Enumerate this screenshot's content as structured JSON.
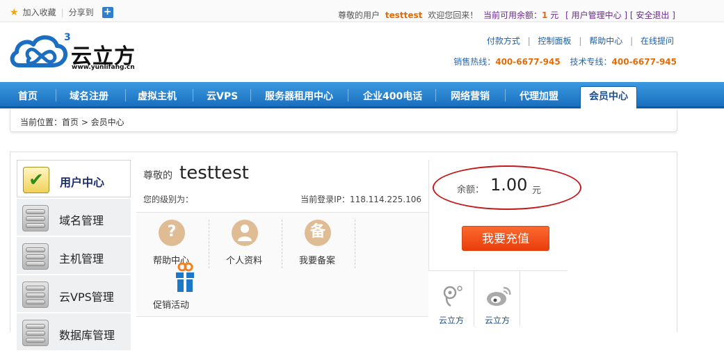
{
  "topbar": {
    "favorite": "加入收藏",
    "share": "分享到",
    "share_plus": "+",
    "greeting_prefix": "尊敬的用户",
    "username": "testtest",
    "welcome": "欢迎您回来！",
    "balance_prefix": "当前可用余额：",
    "balance": "1",
    "balance_unit": "元",
    "user_center": "[ 用户管理中心 ]",
    "logout": "[ 安全退出 ]"
  },
  "header": {
    "logo_cn": "云立方",
    "logo_url": "www.yunlifang.cn",
    "logo_sup": "3",
    "links": [
      "付款方式",
      "控制面板",
      "帮助中心",
      "在线提问"
    ],
    "sales_label": "销售热线：",
    "sales_phone": "400-6677-945",
    "tech_label": "技术专线：",
    "tech_phone": "400-6677-945"
  },
  "nav": {
    "items": [
      "首页",
      "域名注册",
      "虚拟主机",
      "云VPS",
      "服务器租用中心",
      "企业400电话",
      "网络营销",
      "代理加盟"
    ],
    "active": "会员中心"
  },
  "breadcrumb": "当前位置：首页 > 会员中心",
  "sidebar": {
    "items": [
      "用户中心",
      "域名管理",
      "主机管理",
      "云VPS管理",
      "数据库管理"
    ]
  },
  "user": {
    "greeting": "尊敬的",
    "name": "testtest",
    "level": "您的级别为：",
    "login_ip": "当前登录IP：118.114.225.106"
  },
  "balance": {
    "label": "余额：",
    "value": "1.00",
    "unit": "元"
  },
  "recharge_label": "我要充值",
  "tools": [
    {
      "label": "帮助中心",
      "icon": "?"
    },
    {
      "label": "个人资料",
      "icon": "person"
    },
    {
      "label": "我要备案",
      "icon": "备"
    }
  ],
  "promo_label": "促销活动",
  "social": [
    {
      "label": "云立方",
      "icon": "tencent-weibo-icon"
    },
    {
      "label": "云立方",
      "icon": "sina-weibo-icon"
    }
  ],
  "colors": {
    "nav_blue": "#1a6fbf",
    "accent_orange": "#e36c09",
    "recharge_red": "#e93d0d",
    "ellipse_red": "#c4181b"
  }
}
